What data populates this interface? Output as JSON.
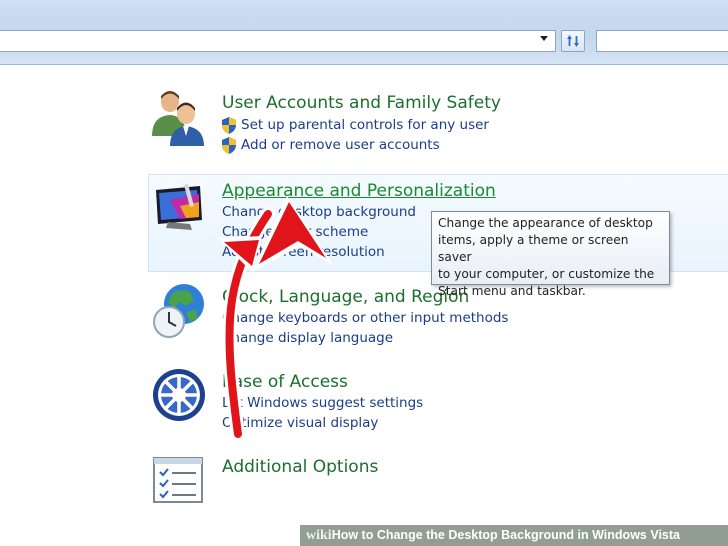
{
  "toolbar": {
    "icons": [
      "dropdown-arrow-icon",
      "refresh-icon"
    ]
  },
  "categories": [
    {
      "title": "User Accounts and Family Safety",
      "icon": "users-icon",
      "links": [
        "Set up parental controls for any user",
        "Add or remove user accounts"
      ]
    },
    {
      "title": "Appearance and Personalization",
      "icon": "display-icon",
      "links": [
        "Change desktop background",
        "Change color scheme",
        "Adjust screen resolution"
      ]
    },
    {
      "title": "Clock, Language, and Region",
      "icon": "globe-clock-icon",
      "links": [
        "Change keyboards or other input methods",
        "Change display language"
      ]
    },
    {
      "title": "Ease of Access",
      "icon": "ease-of-access-icon",
      "links": [
        "Let Windows suggest settings",
        "Optimize visual display"
      ]
    },
    {
      "title": "Additional Options",
      "icon": "checklist-icon",
      "links": []
    }
  ],
  "tooltip": {
    "lines": [
      "Change the appearance of desktop",
      "items, apply a theme or screen saver",
      "to your computer, or customize the",
      "Start menu and taskbar."
    ]
  },
  "footer": {
    "brand": "wiki",
    "how": "How",
    "rest": " to Change the Desktop Background in Windows Vista"
  },
  "colors": {
    "title_green": "#1b6f2d",
    "link_blue": "#1a3d8a",
    "arrow_red": "#e0151c"
  }
}
